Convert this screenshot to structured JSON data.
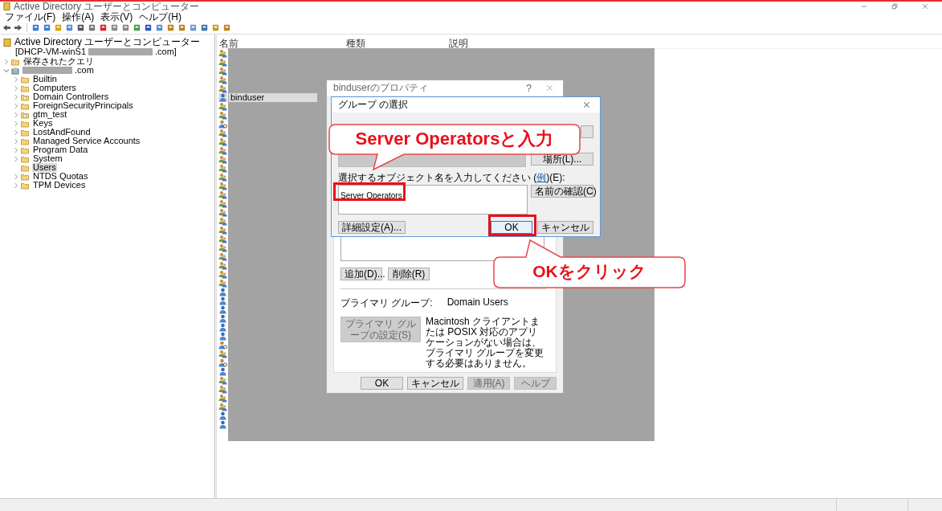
{
  "window": {
    "title": "Active Directory ユーザーとコンピューター"
  },
  "menu": [
    "ファイル(F)",
    "操作(A)",
    "表示(V)",
    "ヘルプ(H)"
  ],
  "tree": {
    "root": {
      "label": "Active Directory ユーザーとコンピューター",
      "server_start": "[DHCP-VM-winS1",
      "server_end": ".com]"
    },
    "items": [
      {
        "label": "保存されたクエリ",
        "kind": "container",
        "expanded": false,
        "selected": false
      },
      {
        "label": ".com",
        "kind": "domain",
        "redacted": true,
        "expanded": true,
        "selected": false,
        "children": [
          {
            "label": "Builtin",
            "kind": "container",
            "expanded": false,
            "selected": false
          },
          {
            "label": "Computers",
            "kind": "container",
            "expanded": false,
            "selected": false
          },
          {
            "label": "Domain Controllers",
            "kind": "ou",
            "expanded": false,
            "selected": false
          },
          {
            "label": "ForeignSecurityPrincipals",
            "kind": "container",
            "expanded": false,
            "selected": false
          },
          {
            "label": "gtm_test",
            "kind": "ou",
            "expanded": false,
            "selected": false
          },
          {
            "label": "Keys",
            "kind": "container",
            "expanded": false,
            "selected": false
          },
          {
            "label": "LostAndFound",
            "kind": "container",
            "expanded": false,
            "selected": false
          },
          {
            "label": "Managed Service Accounts",
            "kind": "container",
            "expanded": false,
            "selected": false
          },
          {
            "label": "Program Data",
            "kind": "container",
            "expanded": false,
            "selected": false
          },
          {
            "label": "System",
            "kind": "container",
            "expanded": false,
            "selected": false
          },
          {
            "label": "Users",
            "kind": "container",
            "selected": true
          },
          {
            "label": "NTDS Quotas",
            "kind": "container",
            "expanded": false,
            "selected": false
          },
          {
            "label": "TPM Devices",
            "kind": "container",
            "expanded": false,
            "selected": false
          }
        ]
      }
    ]
  },
  "list": {
    "columns": [
      "名前",
      "種類",
      "説明"
    ],
    "rows": [
      {
        "kind": "group",
        "selected": false
      },
      {
        "kind": "group",
        "selected": false
      },
      {
        "kind": "group",
        "selected": false
      },
      {
        "kind": "group",
        "selected": false
      },
      {
        "kind": "group",
        "selected": false
      },
      {
        "kind": "user",
        "name": "binduser",
        "selected": true
      },
      {
        "kind": "group",
        "selected": false
      },
      {
        "kind": "group",
        "selected": false
      },
      {
        "kind": "disabled_user",
        "selected": false
      },
      {
        "kind": "group",
        "selected": false
      },
      {
        "kind": "group",
        "selected": false
      },
      {
        "kind": "group",
        "selected": false
      },
      {
        "kind": "group",
        "selected": false
      },
      {
        "kind": "group",
        "selected": false
      },
      {
        "kind": "group",
        "selected": false
      },
      {
        "kind": "group",
        "selected": false
      },
      {
        "kind": "group",
        "selected": false
      },
      {
        "kind": "group",
        "selected": false
      },
      {
        "kind": "group",
        "selected": false
      },
      {
        "kind": "group",
        "selected": false
      },
      {
        "kind": "group",
        "selected": false
      },
      {
        "kind": "group",
        "selected": false
      },
      {
        "kind": "group",
        "selected": false
      },
      {
        "kind": "group",
        "selected": false
      },
      {
        "kind": "group",
        "selected": false
      },
      {
        "kind": "group",
        "selected": false
      },
      {
        "kind": "group",
        "selected": false
      },
      {
        "kind": "user",
        "selected": false
      },
      {
        "kind": "user",
        "selected": false
      },
      {
        "kind": "user",
        "selected": false
      },
      {
        "kind": "user",
        "selected": false
      },
      {
        "kind": "user",
        "selected": false
      },
      {
        "kind": "user",
        "selected": false
      },
      {
        "kind": "disabled_user",
        "selected": false
      },
      {
        "kind": "group",
        "selected": false
      },
      {
        "kind": "disabled_user",
        "selected": false
      },
      {
        "kind": "user",
        "selected": false
      },
      {
        "kind": "group",
        "selected": false
      },
      {
        "kind": "group",
        "selected": false
      },
      {
        "kind": "group",
        "selected": false
      },
      {
        "kind": "group",
        "selected": false
      },
      {
        "kind": "user",
        "selected": false
      },
      {
        "kind": "user",
        "selected": false
      }
    ]
  },
  "properties_dialog": {
    "title": "binduserのプロパティ",
    "help": "?",
    "member_buttons": [
      "追加(D)...",
      "削除(R)"
    ],
    "primary_group_label": "プライマリ グループ:",
    "primary_group": "Domain Users",
    "set_primary_button": {
      "label": "プライマリ グループの設定(S)",
      "disabled": true
    },
    "note": "Macintosh クライアントまたは POSIX 対応のアプリケーションがない場合は、プライマリ グループを変更する必要はありません。",
    "footer_buttons": [
      {
        "label": "OK",
        "disabled": false
      },
      {
        "label": "キャンセル",
        "disabled": false
      },
      {
        "label": "適用(A)",
        "disabled": true
      },
      {
        "label": "ヘルプ",
        "disabled": true
      }
    ]
  },
  "select_dialog": {
    "title": "グループ の選択",
    "location_button": "場所(L)...",
    "names_label_before": "選択するオブジェクト名を入力してください (",
    "names_label_link": "例",
    "names_label_after": ")(E):",
    "object_names": "Server Operators",
    "check_names_button": "名前の確認(C)",
    "advanced_button": "詳細設定(A)...",
    "ok_button": "OK",
    "cancel_button": "キャンセル"
  },
  "annotations": [
    {
      "text": "Server Operatorsと入力"
    },
    {
      "text": "OKをクリック"
    }
  ]
}
